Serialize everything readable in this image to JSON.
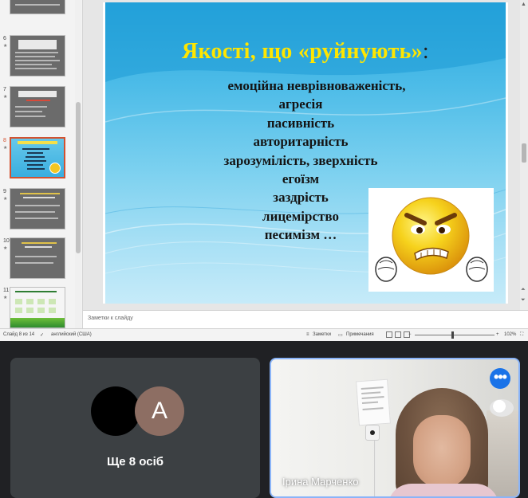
{
  "presentation": {
    "thumbnails": [
      {
        "number": "6",
        "style": "grey"
      },
      {
        "number": "7",
        "style": "grey"
      },
      {
        "number": "8",
        "style": "blue",
        "selected": true
      },
      {
        "number": "9",
        "style": "grey"
      },
      {
        "number": "10",
        "style": "grey"
      },
      {
        "number": "11",
        "style": "green"
      }
    ],
    "slide": {
      "title": "Якості, що «руйнують»",
      "title_colon": ":",
      "title_color": "#ffe600",
      "bullets": [
        "емоційна неврівноваженість,",
        "агресія",
        "пасивність",
        "авторитарність",
        "зарозумілість, зверхність",
        "егоїзм",
        "заздрість",
        "лицемірство",
        "песимізм …"
      ],
      "image": "angry-emoji-icon"
    },
    "notes_placeholder": "Заметки к слайду",
    "status": {
      "slide_counter": "Слайд 8 из 14",
      "language": "английский (США)",
      "notes_button": "Заметки",
      "comments_button": "Примечания",
      "zoom": "102%"
    }
  },
  "meet": {
    "others_avatar_letter": "A",
    "others_label": "Ще 8 осіб",
    "participant_name": "Ірина Марченко",
    "more_button": "•••",
    "accent_color": "#8ab4f8"
  }
}
